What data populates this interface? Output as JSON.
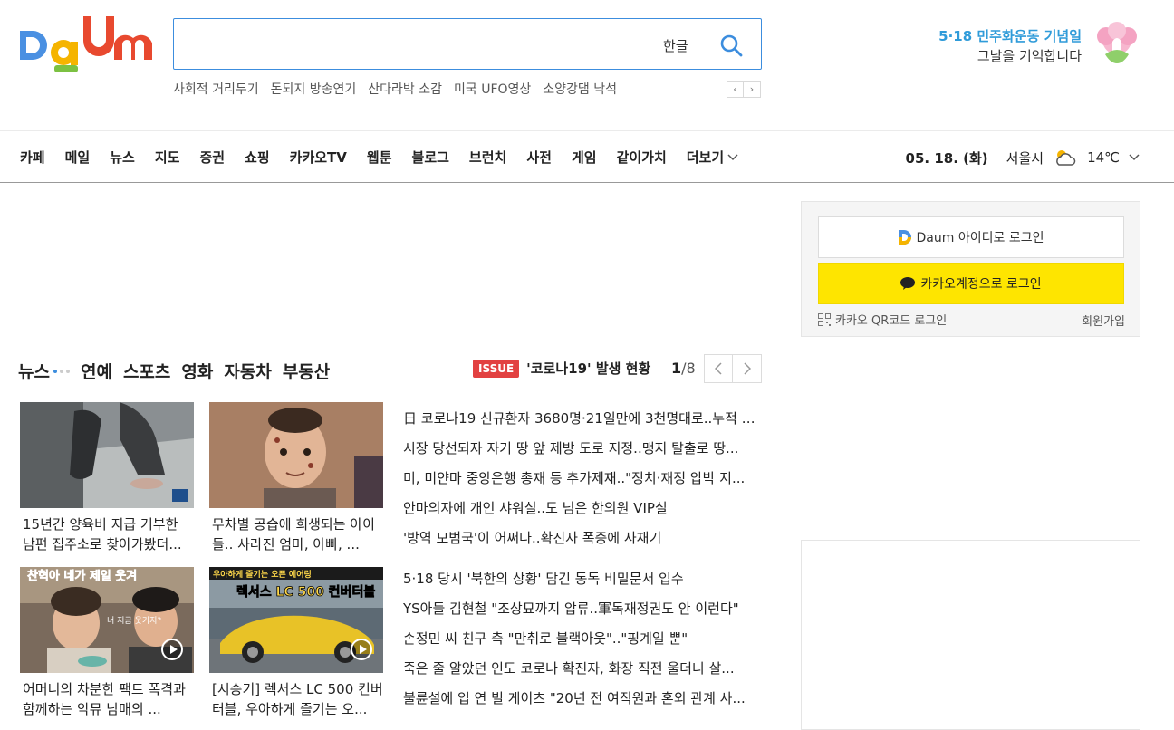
{
  "header": {
    "logo_text": "Daum",
    "search": {
      "value": "",
      "placeholder": "",
      "hangul_label": "한글"
    },
    "trends": [
      "사회적 거리두기",
      "돈되지 방송연기",
      "산다라박 소감",
      "미국 UFO영상",
      "소양강댐 낙석"
    ],
    "trend_prev": "‹",
    "trend_next": "›",
    "memorial": {
      "title": "5·18 민주화운동 기념일",
      "subtitle": "그날을 기억합니다"
    }
  },
  "nav": {
    "items": [
      "카페",
      "메일",
      "뉴스",
      "지도",
      "증권",
      "쇼핑",
      "카카오TV",
      "웹툰",
      "블로그",
      "브런치",
      "사전",
      "게임",
      "같이가치"
    ],
    "more_label": "더보기",
    "date": "05. 18. (화)",
    "city": "서울시",
    "temp": "14℃",
    "weather_icon": "partly-cloudy-icon"
  },
  "login": {
    "daum_label": "Daum 아이디로 로그인",
    "kakao_label": "카카오계정으로 로그인",
    "qr_label": "카카오 QR코드 로그인",
    "signup_label": "회원가입"
  },
  "news": {
    "tabs": [
      "뉴스",
      "연예",
      "스포츠",
      "영화",
      "자동차",
      "부동산"
    ],
    "issue_badge": "ISSUE",
    "issue_text": "'코로나19' 발생 현황",
    "page_current": "1",
    "page_total": "/8",
    "cards": [
      {
        "caption": "15년간 양육비 지급 거부한 남편 집주소로 찾아가봤더..."
      },
      {
        "caption": "무차별 공습에 희생되는 아이들.. 사라진 엄마, 아빠, ..."
      },
      {
        "caption": "어머니의 차분한 팩트 폭격과 함께하는 악뮤 남매의 ..."
      },
      {
        "caption": "[시승기] 렉서스 LC 500 컨버터블, 우아하게 즐기는 오..."
      }
    ],
    "thumb_overlays": {
      "card3_title": "찬혁아 네가 제일 웃겨",
      "card3_sub": "너 지금 웃기지?",
      "card4_top": "우아하게 즐기는 오픈 에어링",
      "card4_title": "렉서스 LC 500 컨버터블"
    },
    "headlines_a": [
      "日 코로나19 신규환자 3680명·21일만에 3천명대로..누적 6...",
      "시장 당선되자 자기 땅 앞 제방 도로 지정..맹지 탈출로 땅...",
      "미, 미얀마 중앙은행 총재 등 추가제재..\"정치·재정 압박 지...",
      "안마의자에 개인 샤워실..도 넘은 한의원 VIP실",
      "'방역 모범국'이 어쩌다..확진자 폭증에 사재기"
    ],
    "headlines_b": [
      "5·18 당시 '북한의 상황' 담긴 동독 비밀문서 입수",
      "YS아들 김현철 \"조상묘까지 압류..軍독재정권도 안 이런다\"",
      "손정민 씨 친구 측 \"만취로 블랙아웃\"..\"핑계일 뿐\"",
      "죽은 줄 알았던 인도 코로나 확진자, 화장 직전 울더니 살...",
      "불륜설에 입 연 빌 게이츠 \"20년 전 여직원과 혼외 관계 사..."
    ]
  },
  "colors": {
    "accent_blue": "#3c8dde",
    "kakao_yellow": "#fee500",
    "issue_red": "#e24141",
    "memorial_blue": "#2f9bd9"
  }
}
